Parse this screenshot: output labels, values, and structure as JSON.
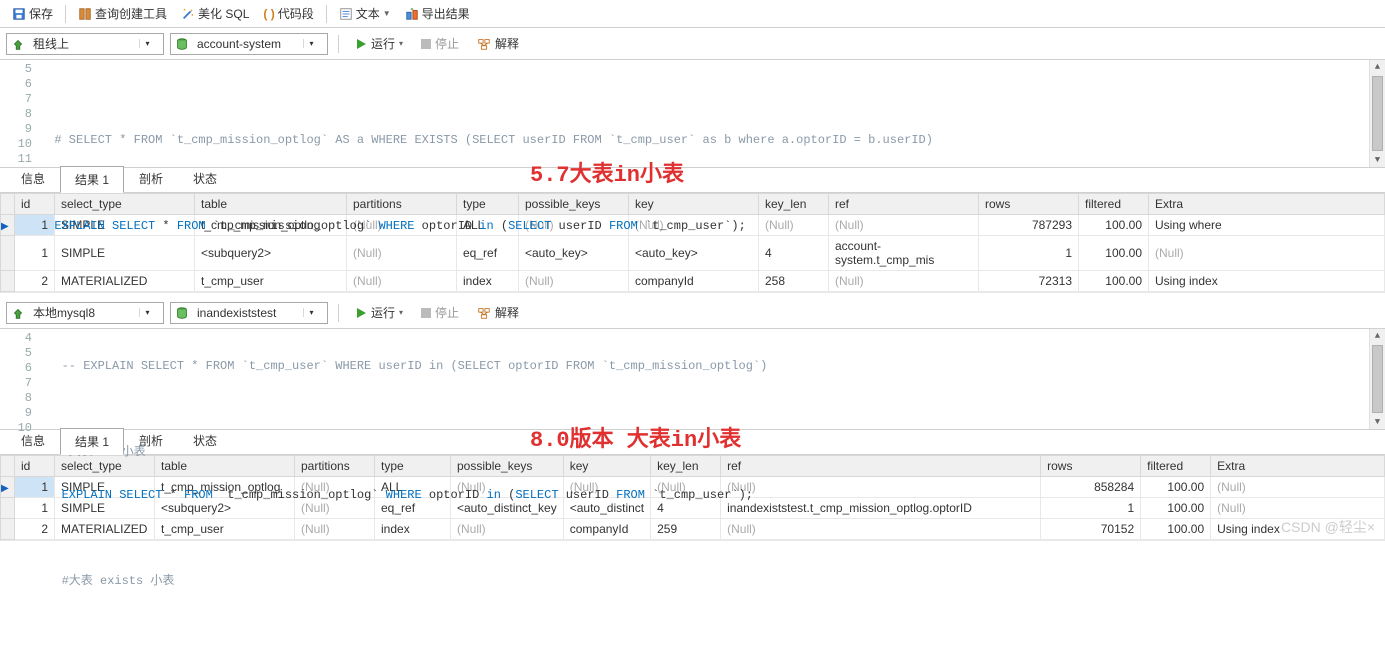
{
  "top_toolbar": {
    "save": "保存",
    "queryBuilder": "查询创建工具",
    "beautify": "美化 SQL",
    "snippet": "代码段",
    "text": "文本",
    "export": "导出结果"
  },
  "panel1": {
    "conn_label": "租线上",
    "db_label": "account-system",
    "run": "运行",
    "stop": "停止",
    "explain": "解释",
    "gutter": [
      "5",
      "6",
      "7",
      "8",
      "9",
      "10",
      "11"
    ],
    "code": {
      "l5": "",
      "l6_cmt": "  # SELECT * FROM `t_cmp_mission_optlog` AS a WHERE EXISTS (SELECT userID FROM `t_cmp_user` as b where a.optorID = b.userID)",
      "l7": "",
      "l8_kw1": "  EXPLAIN SELECT",
      "l8_t1": " * ",
      "l8_kw2": "FROM",
      "l8_t2": " `t_cmp_mission_optlog` ",
      "l8_kw3": "WHERE",
      "l8_t3": " optorID ",
      "l8_kw4": "in",
      "l8_t4": " (",
      "l8_kw5": "SELECT",
      "l8_t5": " userID ",
      "l8_kw6": "FROM",
      "l8_t6": " `t_cmp_user`);",
      "l9": "",
      "l10": "",
      "l11": ""
    },
    "tabs": {
      "info": "信息",
      "result": "结果 1",
      "profile": "剖析",
      "status": "状态"
    },
    "annotation": "5.7大表in小表",
    "cols": [
      "id",
      "select_type",
      "table",
      "partitions",
      "type",
      "possible_keys",
      "key",
      "key_len",
      "ref",
      "rows",
      "filtered",
      "Extra"
    ],
    "rows": [
      {
        "id": "1",
        "select_type": "SIMPLE",
        "table": "t_cmp_mission_optlog",
        "partitions": "(Null)",
        "type": "ALL",
        "possible_keys": "(Null)",
        "key": "(Null)",
        "key_len": "(Null)",
        "ref": "(Null)",
        "rows": "787293",
        "filtered": "100.00",
        "Extra": "Using where"
      },
      {
        "id": "1",
        "select_type": "SIMPLE",
        "table": "<subquery2>",
        "partitions": "(Null)",
        "type": "eq_ref",
        "possible_keys": "<auto_key>",
        "key": "<auto_key>",
        "key_len": "4",
        "ref": "account-system.t_cmp_mis",
        "rows": "1",
        "filtered": "100.00",
        "Extra": "(Null)"
      },
      {
        "id": "2",
        "select_type": "MATERIALIZED",
        "table": "t_cmp_user",
        "partitions": "(Null)",
        "type": "index",
        "possible_keys": "(Null)",
        "key": "companyId",
        "key_len": "258",
        "ref": "(Null)",
        "rows": "72313",
        "filtered": "100.00",
        "Extra": "Using index"
      }
    ]
  },
  "panel2": {
    "conn_label": "本地mysql8",
    "db_label": "inandexiststest",
    "run": "运行",
    "stop": "停止",
    "explain": "解释",
    "gutter": [
      "4",
      "5",
      "6",
      "7",
      "8",
      "9",
      "10"
    ],
    "code": {
      "l4_cmt": "   -- EXPLAIN SELECT * FROM `t_cmp_user` WHERE userID in (SELECT optorID FROM `t_cmp_mission_optlog`)",
      "l5": "",
      "l6_cmt": "   #大表 in 小表",
      "l7_kw1": "   EXPLAIN SELECT",
      "l7_t1": " * ",
      "l7_kw2": "FROM",
      "l7_t2": " `t_cmp_mission_optlog` ",
      "l7_kw3": "WHERE",
      "l7_t3": " optorID ",
      "l7_kw4": "in",
      "l7_t4": " (",
      "l7_kw5": "SELECT",
      "l7_t5": " userID ",
      "l7_kw6": "FROM",
      "l7_t6": " `t_cmp_user`);",
      "l8": "",
      "l9_cmt": "   #大表 exists 小表",
      "l10": ""
    },
    "tabs": {
      "info": "信息",
      "result": "结果 1",
      "profile": "剖析",
      "status": "状态"
    },
    "annotation": "8.0版本 大表in小表",
    "cols": [
      "id",
      "select_type",
      "table",
      "partitions",
      "type",
      "possible_keys",
      "key",
      "key_len",
      "ref",
      "rows",
      "filtered",
      "Extra"
    ],
    "rows": [
      {
        "id": "1",
        "select_type": "SIMPLE",
        "table": "t_cmp_mission_optlog",
        "partitions": "(Null)",
        "type": "ALL",
        "possible_keys": "(Null)",
        "key": "(Null)",
        "key_len": "(Null)",
        "ref": "(Null)",
        "rows": "858284",
        "filtered": "100.00",
        "Extra": "(Null)"
      },
      {
        "id": "1",
        "select_type": "SIMPLE",
        "table": "<subquery2>",
        "partitions": "(Null)",
        "type": "eq_ref",
        "possible_keys": "<auto_distinct_key",
        "key": "<auto_distinct",
        "key_len": "4",
        "ref": "inandexiststest.t_cmp_mission_optlog.optorID",
        "rows": "1",
        "filtered": "100.00",
        "Extra": "(Null)"
      },
      {
        "id": "2",
        "select_type": "MATERIALIZED",
        "table": "t_cmp_user",
        "partitions": "(Null)",
        "type": "index",
        "possible_keys": "(Null)",
        "key": "companyId",
        "key_len": "259",
        "ref": "(Null)",
        "rows": "70152",
        "filtered": "100.00",
        "Extra": "Using index"
      }
    ]
  },
  "watermark": "CSDN @轻尘×"
}
